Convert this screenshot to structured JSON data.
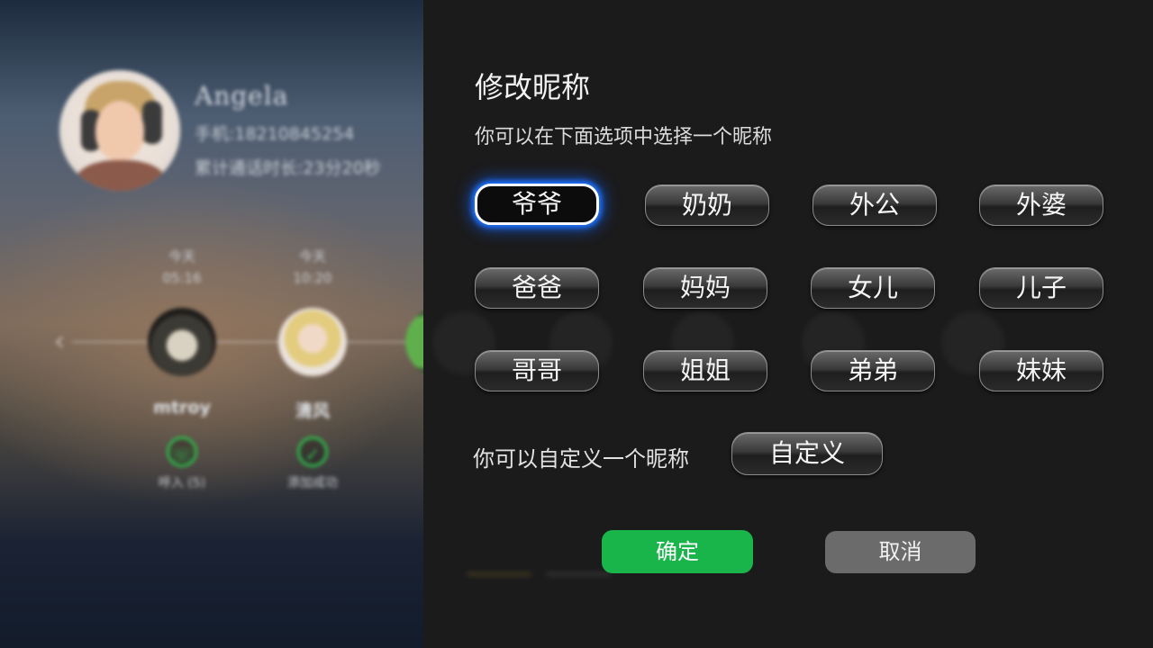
{
  "background": {
    "contact": {
      "name": "Angela",
      "phone": "手机:18210845254",
      "total_call_duration": "累计通话时长:23分20秒"
    },
    "timeline": [
      {
        "day": "今天",
        "time": "05:16",
        "name": "mtroy",
        "action": "呼入 (5)",
        "action_icon": "phone-icon"
      },
      {
        "day": "今天",
        "time": "10:20",
        "name": "清风",
        "action": "添加成功",
        "action_icon": "check-icon"
      }
    ]
  },
  "dialog": {
    "title": "修改昵称",
    "subtitle": "你可以在下面选项中选择一个昵称",
    "options": [
      "爷爷",
      "奶奶",
      "外公",
      "外婆",
      "爸爸",
      "妈妈",
      "女儿",
      "儿子",
      "哥哥",
      "姐姐",
      "弟弟",
      "妹妹"
    ],
    "focused_option": "爷爷",
    "custom_prompt": "你可以自定义一个昵称",
    "custom_button": "自定义",
    "confirm_button": "确定",
    "cancel_button": "取消"
  },
  "colors": {
    "confirm": "#19b54a",
    "cancel": "#6b6b6b",
    "focus_glow": "#1e74ff",
    "dialog_bg": "#1b1b1c"
  }
}
